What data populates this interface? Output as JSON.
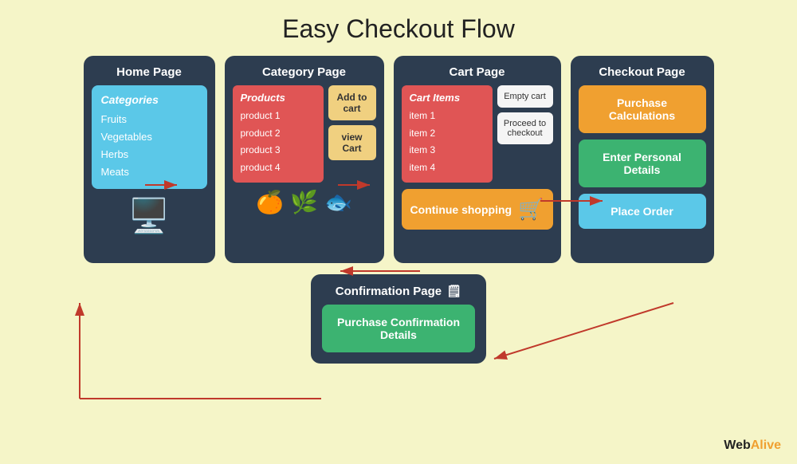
{
  "title": "Easy Checkout Flow",
  "pages": {
    "home": {
      "title": "Home Page",
      "categories_title": "Categories",
      "categories": [
        "Fruits",
        "Vegetables",
        "Herbs",
        "Meats"
      ]
    },
    "category": {
      "title": "Category Page",
      "products_title": "Products",
      "products": [
        "product 1",
        "product 2",
        "product 3",
        "product 4"
      ],
      "add_to_cart": "Add to cart",
      "view_cart": "view Cart",
      "emojis": [
        "🍊",
        "🌿",
        "🐟"
      ]
    },
    "cart": {
      "title": "Cart Page",
      "cart_items_title": "Cart Items",
      "cart_items": [
        "item 1",
        "item 2",
        "item 3",
        "item 4"
      ],
      "empty_cart": "Empty cart",
      "proceed_to_checkout": "Proceed to checkout",
      "continue_shopping": "Continue shopping"
    },
    "checkout": {
      "title": "Checkout Page",
      "purchase_calculations": "Purchase Calculations",
      "enter_personal_details": "Enter Personal Details",
      "place_order": "Place Order"
    },
    "confirmation": {
      "title": "Confirmation Page",
      "icon": "🗒",
      "details": "Purchase Confirmation Details"
    }
  },
  "brand": {
    "web": "Web",
    "alive": "Alive"
  }
}
